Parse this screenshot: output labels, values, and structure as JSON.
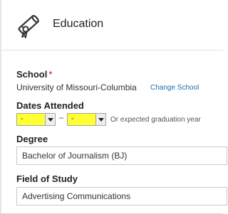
{
  "section": {
    "title": "Education",
    "icon": "diploma-icon"
  },
  "school": {
    "label": "School",
    "required_marker": "*",
    "value": "University of Missouri-Columbia",
    "change_link": "Change School"
  },
  "dates": {
    "label": "Dates Attended",
    "start_value": "-",
    "separator": "–",
    "end_value": "-",
    "hint": "Or expected graduation year",
    "highlight_color": "#ffff33"
  },
  "degree": {
    "label": "Degree",
    "value": "Bachelor of Journalism (BJ)"
  },
  "field_of_study": {
    "label": "Field of Study",
    "value": "Advertising Communications"
  },
  "colors": {
    "link": "#1a6fb0",
    "required": "#cc0000"
  }
}
